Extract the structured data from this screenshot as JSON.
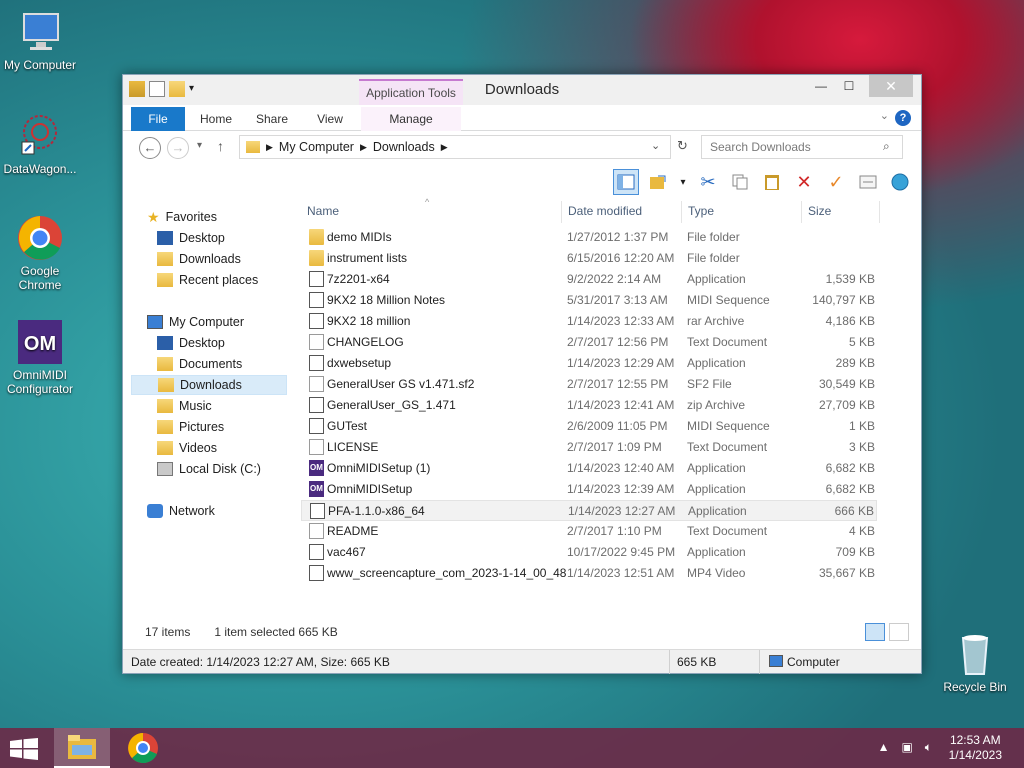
{
  "desktop": {
    "icons": [
      {
        "label": "My Computer"
      },
      {
        "label": "DataWagon..."
      },
      {
        "label": "Google Chrome"
      },
      {
        "label": "OmniMIDI Configurator"
      },
      {
        "label": "Recycle Bin"
      }
    ]
  },
  "window": {
    "title": "Downloads",
    "app_tools": "Application Tools",
    "tabs": [
      "File",
      "Home",
      "Share",
      "View",
      "Manage"
    ],
    "min_btn": "—",
    "max_btn": "☐",
    "close_btn": "✕",
    "help": "?"
  },
  "address": {
    "back": "←",
    "forward": "→",
    "up": "↑",
    "crumbs": [
      "My Computer",
      "Downloads"
    ],
    "search_placeholder": "Search Downloads"
  },
  "nav": {
    "favorites_label": "Favorites",
    "favorites": [
      "Desktop",
      "Downloads",
      "Recent places"
    ],
    "computer_label": "My Computer",
    "computer": [
      "Desktop",
      "Documents",
      "Downloads",
      "Music",
      "Pictures",
      "Videos",
      "Local Disk (C:)"
    ],
    "network_label": "Network"
  },
  "columns": {
    "name": "Name",
    "date": "Date modified",
    "type": "Type",
    "size": "Size"
  },
  "files": [
    {
      "name": "demo MIDIs",
      "date": "1/27/2012 1:37 PM",
      "type": "File folder",
      "size": "",
      "icon": "folder-icon"
    },
    {
      "name": "instrument lists",
      "date": "6/15/2016 12:20 AM",
      "type": "File folder",
      "size": "",
      "icon": "folder-icon"
    },
    {
      "name": "7z2201-x64",
      "date": "9/2/2022 2:14 AM",
      "type": "Application",
      "size": "1,539 KB",
      "icon": "7zip-icon"
    },
    {
      "name": "9KX2 18 Million Notes",
      "date": "5/31/2017 3:13 AM",
      "type": "MIDI Sequence",
      "size": "140,797 KB",
      "icon": "midi-file-icon"
    },
    {
      "name": "9KX2 18 million",
      "date": "1/14/2023 12:33 AM",
      "type": "rar Archive",
      "size": "4,186 KB",
      "icon": "archive-icon"
    },
    {
      "name": "CHANGELOG",
      "date": "2/7/2017 12:56 PM",
      "type": "Text Document",
      "size": "5 KB",
      "icon": "text-file-icon"
    },
    {
      "name": "dxwebsetup",
      "date": "1/14/2023 12:29 AM",
      "type": "Application",
      "size": "289 KB",
      "icon": "setup-icon"
    },
    {
      "name": "GeneralUser GS v1.471.sf2",
      "date": "2/7/2017 12:55 PM",
      "type": "SF2 File",
      "size": "30,549 KB",
      "icon": "generic-file-icon"
    },
    {
      "name": "GeneralUser_GS_1.471",
      "date": "1/14/2023 12:41 AM",
      "type": "zip Archive",
      "size": "27,709 KB",
      "icon": "archive-icon"
    },
    {
      "name": "GUTest",
      "date": "2/6/2009 11:05 PM",
      "type": "MIDI Sequence",
      "size": "1 KB",
      "icon": "midi-file-icon"
    },
    {
      "name": "LICENSE",
      "date": "2/7/2017 1:09 PM",
      "type": "Text Document",
      "size": "3 KB",
      "icon": "text-file-icon"
    },
    {
      "name": "OmniMIDISetup (1)",
      "date": "1/14/2023 12:40 AM",
      "type": "Application",
      "size": "6,682 KB",
      "icon": "omnimidi-icon"
    },
    {
      "name": "OmniMIDISetup",
      "date": "1/14/2023 12:39 AM",
      "type": "Application",
      "size": "6,682 KB",
      "icon": "omnimidi-icon"
    },
    {
      "name": "PFA-1.1.0-x86_64",
      "date": "1/14/2023 12:27 AM",
      "type": "Application",
      "size": "666 KB",
      "icon": "piano-icon"
    },
    {
      "name": "README",
      "date": "2/7/2017 1:10 PM",
      "type": "Text Document",
      "size": "4 KB",
      "icon": "text-file-icon"
    },
    {
      "name": "vac467",
      "date": "10/17/2022 9:45 PM",
      "type": "Application",
      "size": "709 KB",
      "icon": "setup-icon"
    },
    {
      "name": "www_screencapture_com_2023-1-14_00_48",
      "date": "1/14/2023 12:51 AM",
      "type": "MP4 Video",
      "size": "35,667 KB",
      "icon": "video-file-icon"
    }
  ],
  "status": {
    "count": "17 items",
    "selected": "1 item selected  665 KB",
    "bar_info": "Date created: 1/14/2023 12:27 AM, Size: 665 KB",
    "bar_size": "665 KB",
    "bar_location": "Computer"
  },
  "taskbar": {
    "time": "12:53 AM",
    "date": "1/14/2023"
  }
}
